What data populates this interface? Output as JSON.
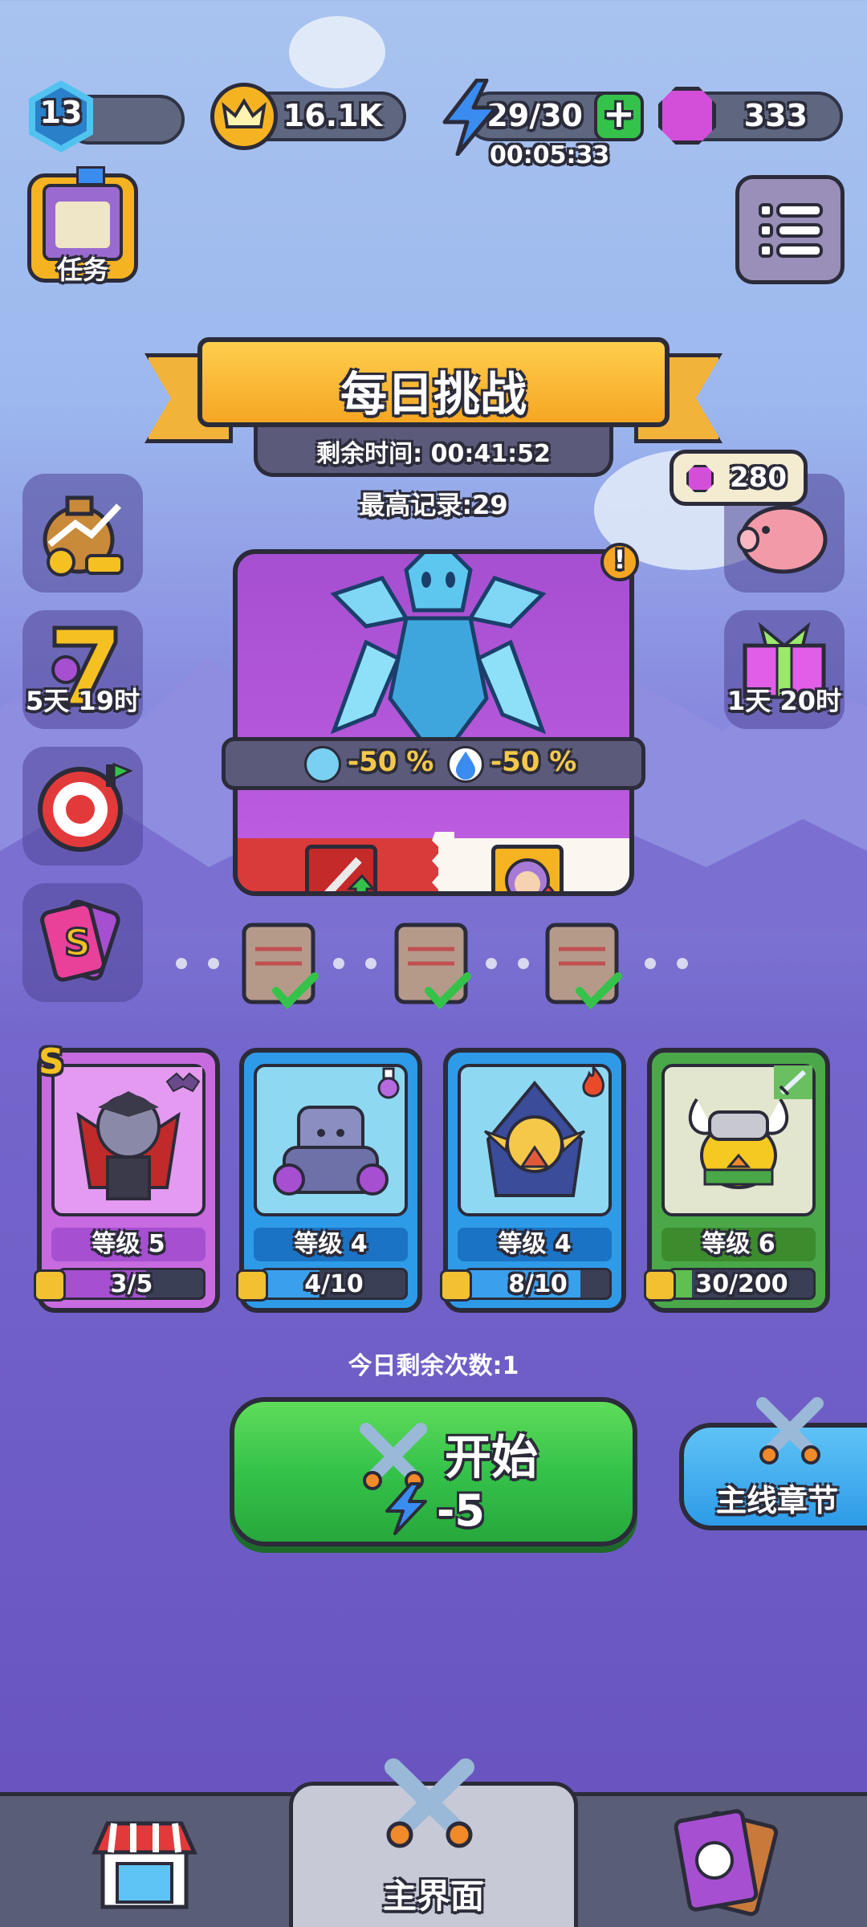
{
  "top_bar": {
    "level": "13",
    "level_progress": 0.08,
    "gold": "16.1K",
    "energy": "29/30",
    "energy_timer": "00:05:33",
    "gems": "333"
  },
  "left_menu": {
    "tasks_label": "任务",
    "event_timer": "5天 19时"
  },
  "right_menu": {
    "piggy_gems": "280",
    "gift_timer": "1天 20时"
  },
  "challenge": {
    "title": "每日挑战",
    "remaining_time": "剩余时间:  00:41:52",
    "best_record": "最高记录:29",
    "resist_1": "-50 %",
    "resist_2": "-50 %"
  },
  "heroes": [
    {
      "rank": "S",
      "level": "等级 5",
      "progress": "3/5",
      "progress_value": 0.6
    },
    {
      "level": "等级 4",
      "progress": "4/10",
      "progress_value": 0.4
    },
    {
      "level": "等级 4",
      "progress": "8/10",
      "progress_value": 0.8
    },
    {
      "level": "等级 6",
      "progress": "30/200",
      "progress_value": 0.15
    }
  ],
  "attempts_left": "今日剩余次数:1",
  "start_button": {
    "label": "开始",
    "cost": "-5"
  },
  "main_chapter_button": "主线章节",
  "bottom_nav": {
    "home_label": "主界面"
  },
  "colors": {
    "gold": "#f5b322",
    "energy": "#3a8cf0",
    "gem": "#d34fd9",
    "start_green": "#35c24a",
    "chapter_blue": "#2e9be8"
  }
}
